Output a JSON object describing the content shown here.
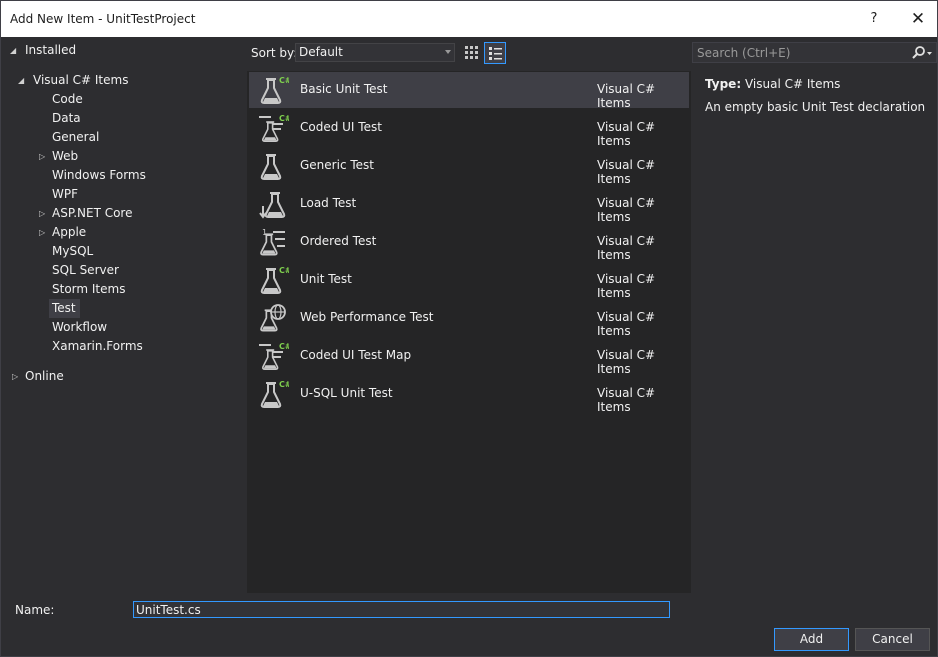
{
  "window": {
    "title": "Add New Item - UnitTestProject",
    "help_label": "?",
    "close_label": "✕"
  },
  "tree": {
    "installed": "Installed",
    "visual_csharp": "Visual C# Items",
    "children": [
      "Code",
      "Data",
      "General",
      "Web",
      "Windows Forms",
      "WPF",
      "ASP.NET Core",
      "Apple",
      "MySQL",
      "SQL Server",
      "Storm Items",
      "Test",
      "Workflow",
      "Xamarin.Forms"
    ],
    "selected": "Test",
    "online": "Online"
  },
  "toolbar": {
    "sort_label": "Sort by:",
    "sort_value": "Default"
  },
  "search": {
    "placeholder": "Search (Ctrl+E)"
  },
  "items": [
    {
      "name": "Basic Unit Test",
      "category": "Visual C# Items",
      "icon": "flask-csharp-icon"
    },
    {
      "name": "Coded UI Test",
      "category": "Visual C# Items",
      "icon": "coded-ui-test-icon"
    },
    {
      "name": "Generic Test",
      "category": "Visual C# Items",
      "icon": "flask-icon"
    },
    {
      "name": "Load Test",
      "category": "Visual C# Items",
      "icon": "load-test-icon"
    },
    {
      "name": "Ordered Test",
      "category": "Visual C# Items",
      "icon": "ordered-test-icon"
    },
    {
      "name": "Unit Test",
      "category": "Visual C# Items",
      "icon": "flask-csharp-icon"
    },
    {
      "name": "Web Performance Test",
      "category": "Visual C# Items",
      "icon": "web-performance-test-icon"
    },
    {
      "name": "Coded UI Test Map",
      "category": "Visual C# Items",
      "icon": "coded-ui-test-icon"
    },
    {
      "name": "U-SQL Unit Test",
      "category": "Visual C# Items",
      "icon": "flask-csharp-icon"
    }
  ],
  "details": {
    "type_label": "Type:",
    "type_value": "Visual C# Items",
    "description": "An empty basic Unit Test declaration"
  },
  "footer": {
    "name_label": "Name:",
    "name_value": "UnitTest.cs",
    "add_label": "Add",
    "cancel_label": "Cancel"
  },
  "colors": {
    "accent": "#3399ff",
    "background": "#2d2d30",
    "list_background": "#252526",
    "selected": "#3f3f46",
    "csharp_badge": "#7fd04e"
  }
}
